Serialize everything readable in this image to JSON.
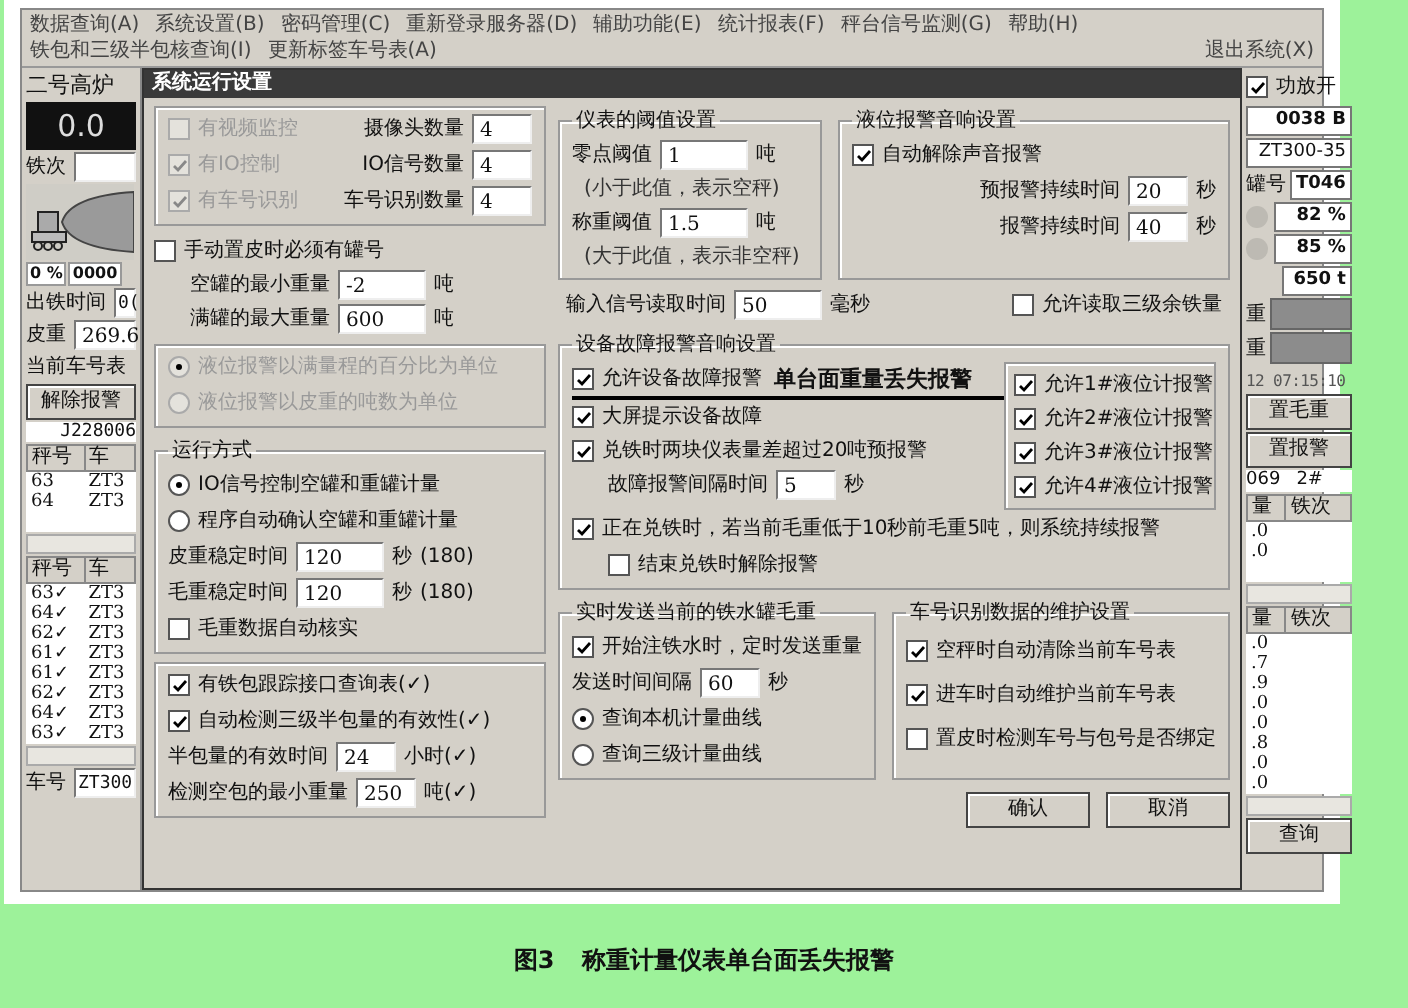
{
  "menu": [
    {
      "label": "数据查询(A)"
    },
    {
      "label": "系统设置(B)"
    },
    {
      "label": "密码管理(C)"
    },
    {
      "label": "重新登录服务器(D)"
    },
    {
      "label": "辅助功能(E)"
    },
    {
      "label": "统计报表(F)"
    },
    {
      "label": "秤台信号监测(G)"
    },
    {
      "label": "帮助(H)"
    },
    {
      "label": "铁包和三级半包核查询(I)"
    },
    {
      "label": "更新标签车号表(A)"
    }
  ],
  "exit": "退出系统(X)",
  "left": {
    "title": "二号高炉",
    "display": "0.0",
    "batch_label": "铁次",
    "percent": "0 %",
    "code": "0000",
    "tap_time_label": "出铁时间",
    "tap_time_value": "0(",
    "tare_label": "皮重",
    "tare_value": "269.6",
    "car_table_label": "当前车号表",
    "clear_alarm_button": "解除报警",
    "ladle_id": "J228006",
    "table1": {
      "columns": [
        "秤号",
        "车"
      ],
      "rows": [
        [
          "63",
          "ZT3"
        ],
        [
          "64",
          "ZT3"
        ]
      ]
    },
    "table2": {
      "columns": [
        "秤号",
        "车"
      ],
      "rows": [
        [
          "63✓",
          "ZT3"
        ],
        [
          "64✓",
          "ZT3"
        ],
        [
          "62✓",
          "ZT3"
        ],
        [
          "61✓",
          "ZT3"
        ],
        [
          "61✓",
          "ZT3"
        ],
        [
          "62✓",
          "ZT3"
        ],
        [
          "64✓",
          "ZT3"
        ],
        [
          "63✓",
          "ZT3"
        ]
      ]
    },
    "car_no_label": "车号",
    "car_no_value": "ZT300"
  },
  "right": {
    "amp": {
      "label": "功放开",
      "checked": true
    },
    "code": "0038 B",
    "car": "ZT300-35",
    "tank_label": "罐号",
    "tank": "T046",
    "levels": [
      "82 %",
      "85 %"
    ],
    "weight": "650 t",
    "weight_labels": [
      "重",
      "重"
    ],
    "time": "12 07:15:10",
    "buttons": [
      "置毛重",
      "置报警"
    ],
    "ladle": "069",
    "ladle_no": "2#",
    "table1": {
      "columns": [
        "量",
        "铁次"
      ],
      "rows": [
        [
          ".0",
          ""
        ],
        [
          ".0",
          ""
        ]
      ]
    },
    "table2": {
      "columns": [
        "量",
        "铁次"
      ],
      "rows": [
        [
          ".0",
          ""
        ],
        [
          ".7",
          ""
        ],
        [
          ".9",
          ""
        ],
        [
          ".0",
          ""
        ],
        [
          ".0",
          ""
        ],
        [
          ".8",
          ""
        ],
        [
          ".0",
          ""
        ],
        [
          ".0",
          ""
        ]
      ]
    },
    "query_button": "查询"
  },
  "dialog": {
    "title": "系统运行设置",
    "devices": {
      "options": [
        {
          "label": "有视频监控",
          "checked": false,
          "disabled": true
        },
        {
          "label": "有IO控制",
          "checked": true,
          "disabled": true
        },
        {
          "label": "有车号识别",
          "checked": true,
          "disabled": true
        }
      ],
      "counts": [
        {
          "label": "摄像头数量",
          "value": "4"
        },
        {
          "label": "IO信号数量",
          "value": "4"
        },
        {
          "label": "车号识别数量",
          "value": "4"
        }
      ]
    },
    "manual_tare": {
      "option": {
        "label": "手动置皮时必须有罐号",
        "checked": false
      },
      "fields": [
        {
          "label": "空罐的最小重量",
          "value": "-2",
          "unit": "吨"
        },
        {
          "label": "满罐的最大重量",
          "value": "600",
          "unit": "吨"
        }
      ]
    },
    "level_unit": [
      {
        "label": "液位报警以满量程的百分比为单位",
        "selected": true,
        "disabled": true
      },
      {
        "label": "液位报警以皮重的吨数为单位",
        "selected": false,
        "disabled": true
      }
    ],
    "run_mode": {
      "title": "运行方式",
      "modes": [
        {
          "label": "IO信号控制空罐和重罐计量",
          "selected": true
        },
        {
          "label": "程序自动确认空罐和重罐计量",
          "selected": false
        }
      ],
      "fields": [
        {
          "label": "皮重稳定时间",
          "value": "120",
          "unit": "秒",
          "note": "(180)"
        },
        {
          "label": "毛重稳定时间",
          "value": "120",
          "unit": "秒",
          "note": "(180)"
        }
      ],
      "option": {
        "label": "毛重数据自动核实",
        "checked": false
      }
    },
    "ladle": {
      "options": [
        {
          "label": "有铁包跟踪接口查询表(✓)",
          "checked": true
        },
        {
          "label": "自动检测三级半包量的有效性(✓)",
          "checked": true
        }
      ],
      "fields": [
        {
          "label": "半包量的有效时间",
          "value": "24",
          "unit": "小时(✓)"
        },
        {
          "label": "检测空包的最小重量",
          "value": "250",
          "unit": "吨(✓)"
        }
      ]
    },
    "thresholds": {
      "title": "仪表的阈值设置",
      "items": [
        {
          "label": "零点阈值",
          "value": "1",
          "unit": "吨",
          "hint": "(小于此值，表示空秤)"
        },
        {
          "label": "称重阈值",
          "value": "1.5",
          "unit": "吨",
          "hint": "(大于此值，表示非空秤)"
        }
      ]
    },
    "level_alarm_sound": {
      "title": "液位报警音响设置",
      "option": {
        "label": "自动解除声音报警",
        "checked": true
      },
      "fields": [
        {
          "label": "预报警持续时间",
          "value": "20",
          "unit": "秒"
        },
        {
          "label": "报警持续时间",
          "value": "40",
          "unit": "秒"
        }
      ]
    },
    "signal_read": {
      "label": "输入信号读取时间",
      "value": "50",
      "unit": "毫秒"
    },
    "read_remaining": {
      "label": "允许读取三级余铁量",
      "checked": false
    },
    "fault_alarm": {
      "title": "设备故障报警音响设置",
      "annotation": "单台面重量丢失报警",
      "options": [
        {
          "label": "允许设备故障报警",
          "checked": true
        },
        {
          "label": "大屏提示设备故障",
          "checked": true
        },
        {
          "label": "兑铁时两块仪表量差超过20吨预报警",
          "checked": true
        }
      ],
      "interval": {
        "label": "故障报警间隔时间",
        "value": "5",
        "unit": "秒"
      },
      "persist_options": [
        {
          "label": "正在兑铁时，若当前毛重低于10秒前毛重5吨，则系统持续报警",
          "checked": true
        },
        {
          "label": "结束兑铁时解除报警",
          "checked": false
        }
      ],
      "level_meters": [
        {
          "label": "允许1#液位计报警",
          "checked": true
        },
        {
          "label": "允许2#液位计报警",
          "checked": true
        },
        {
          "label": "允许3#液位计报警",
          "checked": true
        },
        {
          "label": "允许4#液位计报警",
          "checked": true
        }
      ]
    },
    "realtime_send": {
      "title": "实时发送当前的铁水罐毛重",
      "option": {
        "label": "开始注铁水时，定时发送重量",
        "checked": true
      },
      "interval": {
        "label": "发送时间间隔",
        "value": "60",
        "unit": "秒"
      },
      "curves": [
        {
          "label": "查询本机计量曲线",
          "selected": true
        },
        {
          "label": "查询三级计量曲线",
          "selected": false
        }
      ]
    },
    "car_id": {
      "title": "车号识别数据的维护设置",
      "options": [
        {
          "label": "空秤时自动清除当前车号表",
          "checked": true
        },
        {
          "label": "进车时自动维护当前车号表",
          "checked": true
        },
        {
          "label": "置皮时检测车号与包号是否绑定",
          "checked": false
        }
      ]
    },
    "buttons": [
      "确认",
      "取消"
    ]
  },
  "caption": {
    "figure": "图3",
    "text": "称重计量仪表单台面丢失报警"
  }
}
